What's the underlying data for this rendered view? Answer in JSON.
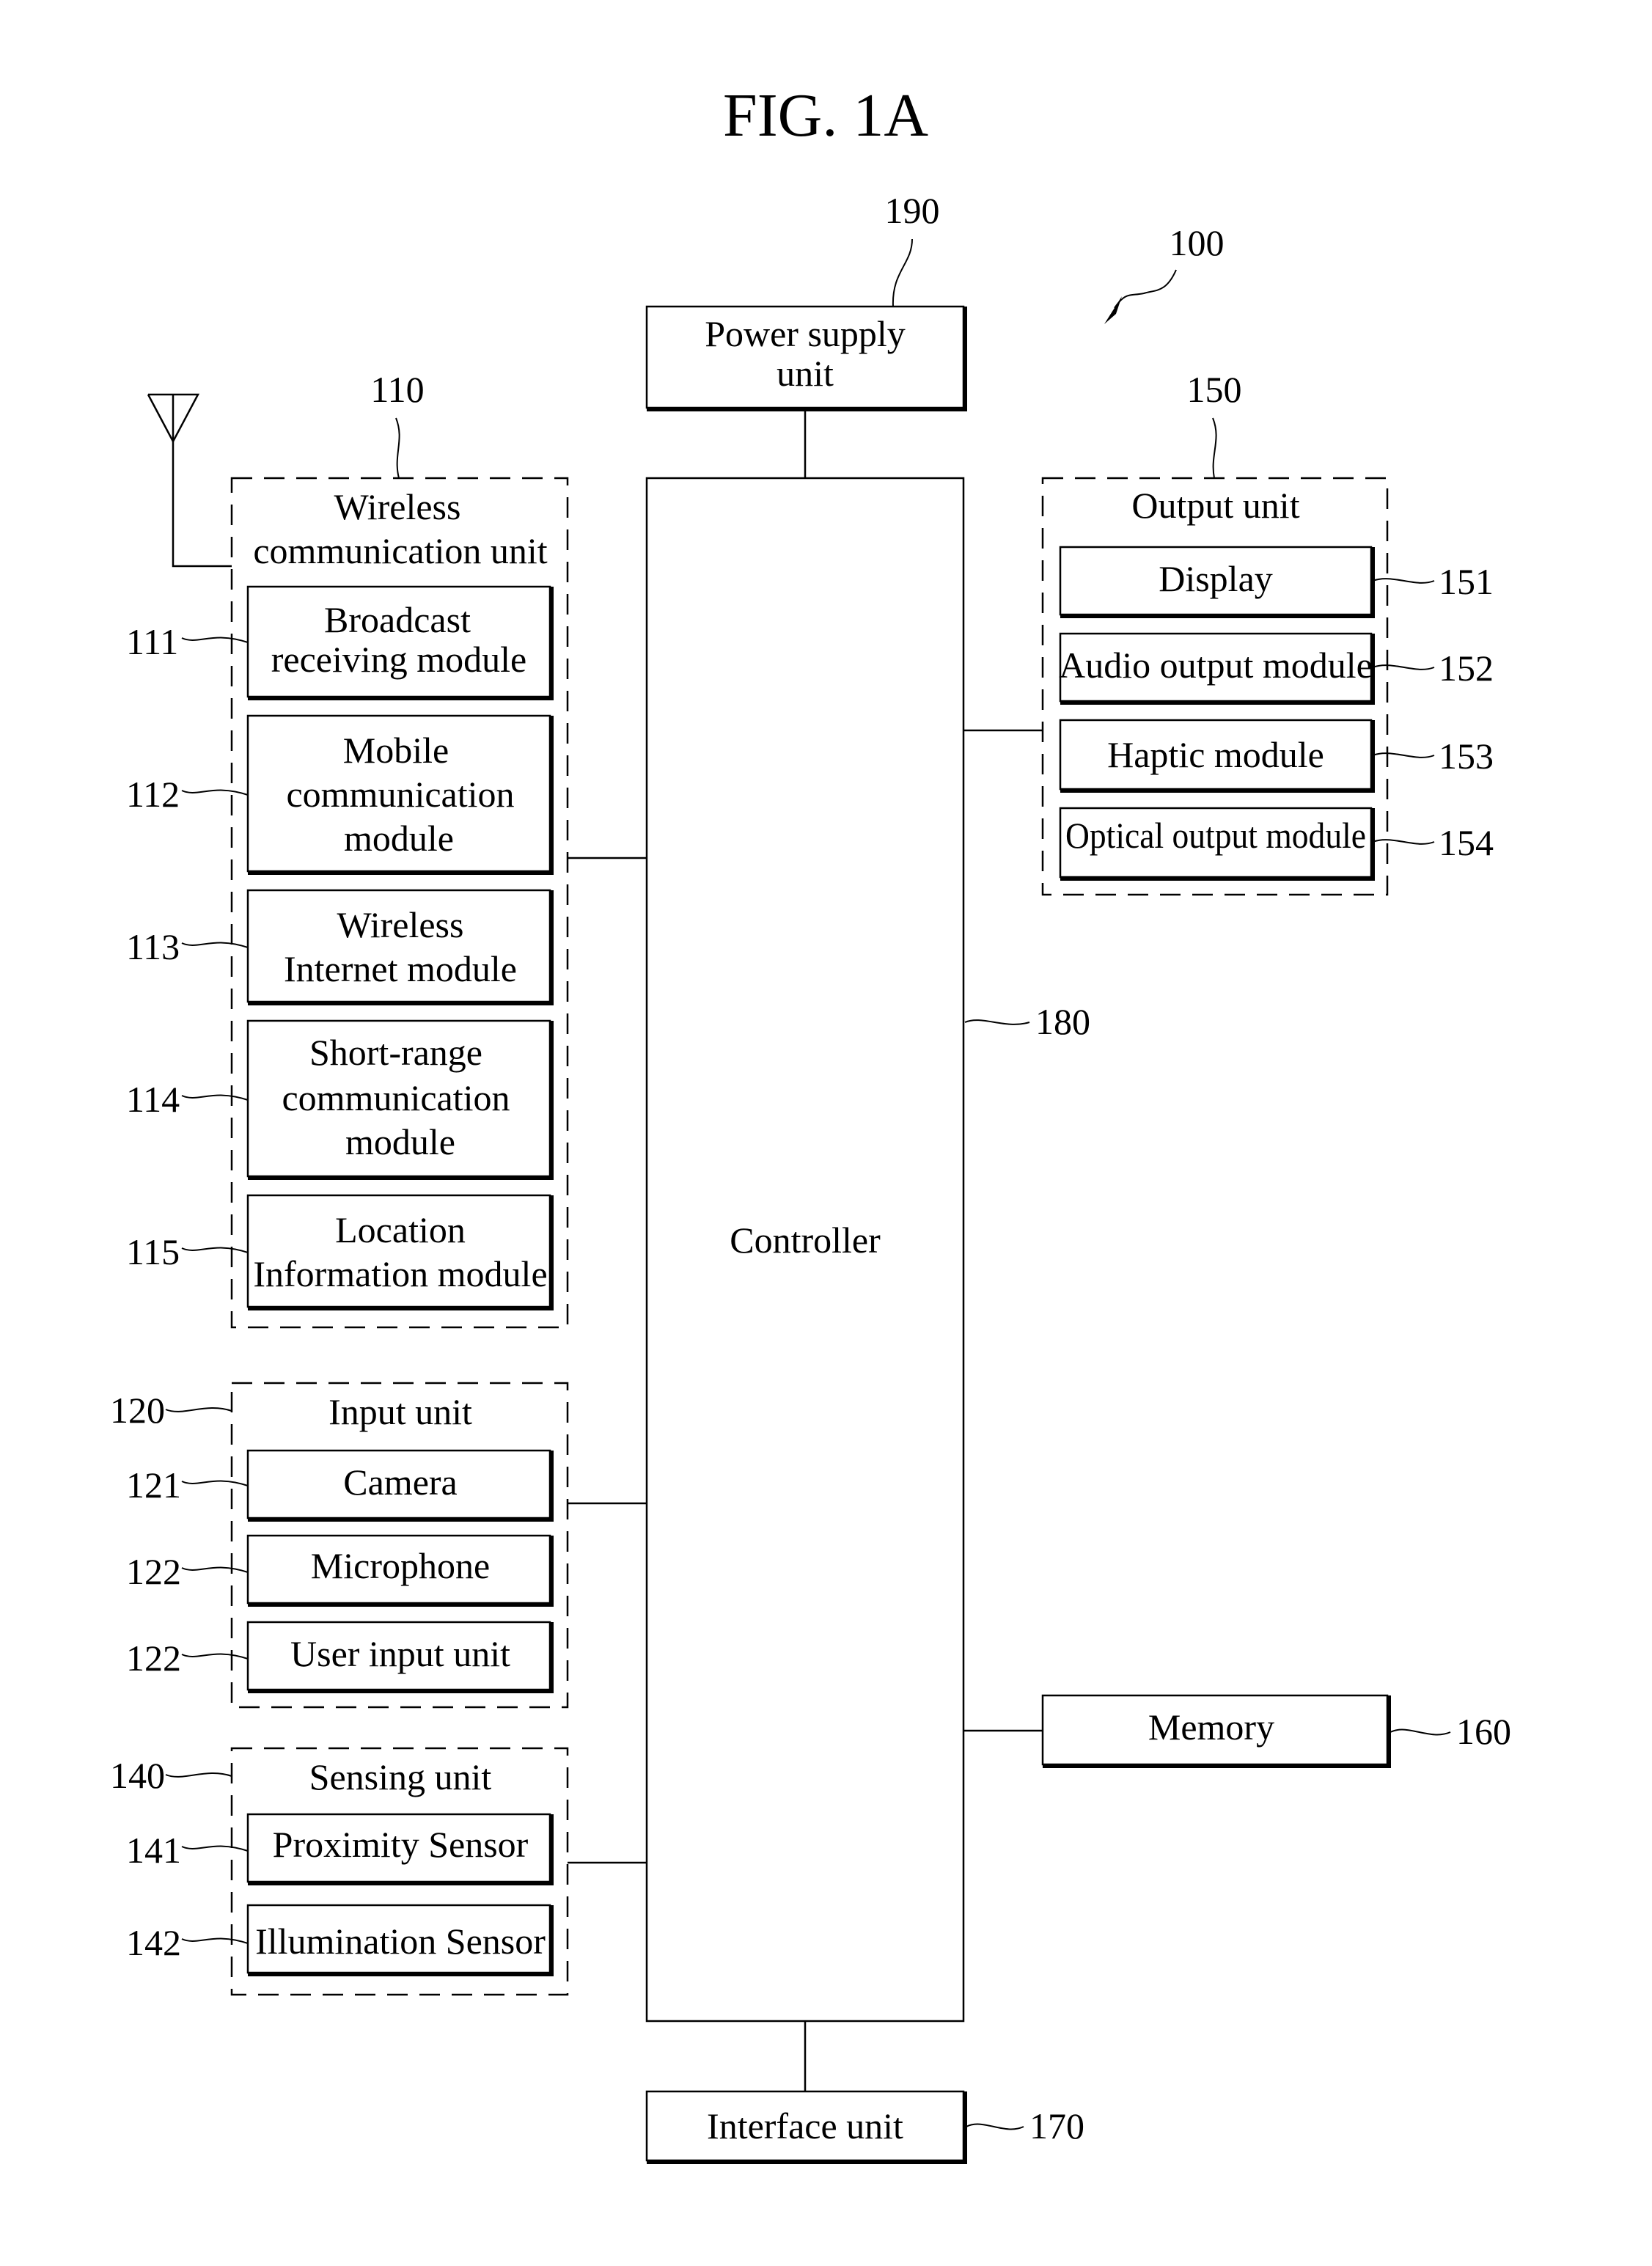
{
  "figure": {
    "title": "FIG. 1A",
    "device_ref": "100"
  },
  "power_supply": {
    "ref": "190",
    "lines": [
      "Power supply",
      "unit"
    ]
  },
  "controller": {
    "ref": "180",
    "label": "Controller"
  },
  "interface": {
    "ref": "170",
    "label": "Interface unit"
  },
  "memory": {
    "ref": "160",
    "label": "Memory"
  },
  "wireless_unit": {
    "ref": "110",
    "lines": [
      "Wireless",
      "communication unit"
    ],
    "modules": [
      {
        "ref": "111",
        "lines": [
          "Broadcast",
          "receiving module"
        ]
      },
      {
        "ref": "112",
        "lines": [
          "Mobile",
          "communication",
          "module"
        ]
      },
      {
        "ref": "113",
        "lines": [
          "Wireless",
          "Internet module"
        ]
      },
      {
        "ref": "114",
        "lines": [
          "Short-range",
          "communication",
          "module"
        ]
      },
      {
        "ref": "115",
        "lines": [
          "Location",
          "Information module"
        ]
      }
    ]
  },
  "input_unit": {
    "ref": "120",
    "label": "Input unit",
    "modules": [
      {
        "ref": "121",
        "label": "Camera"
      },
      {
        "ref": "122",
        "label": "Microphone"
      },
      {
        "ref": "122",
        "label": "User input unit"
      }
    ]
  },
  "sensing_unit": {
    "ref": "140",
    "label": "Sensing unit",
    "modules": [
      {
        "ref": "141",
        "label": "Proximity Sensor"
      },
      {
        "ref": "142",
        "label": "Illumination Sensor"
      }
    ]
  },
  "output_unit": {
    "ref": "150",
    "label": "Output unit",
    "modules": [
      {
        "ref": "151",
        "label": "Display"
      },
      {
        "ref": "152",
        "label": "Audio output module"
      },
      {
        "ref": "153",
        "label": "Haptic module"
      },
      {
        "ref": "154",
        "label": "Optical output module"
      }
    ]
  }
}
